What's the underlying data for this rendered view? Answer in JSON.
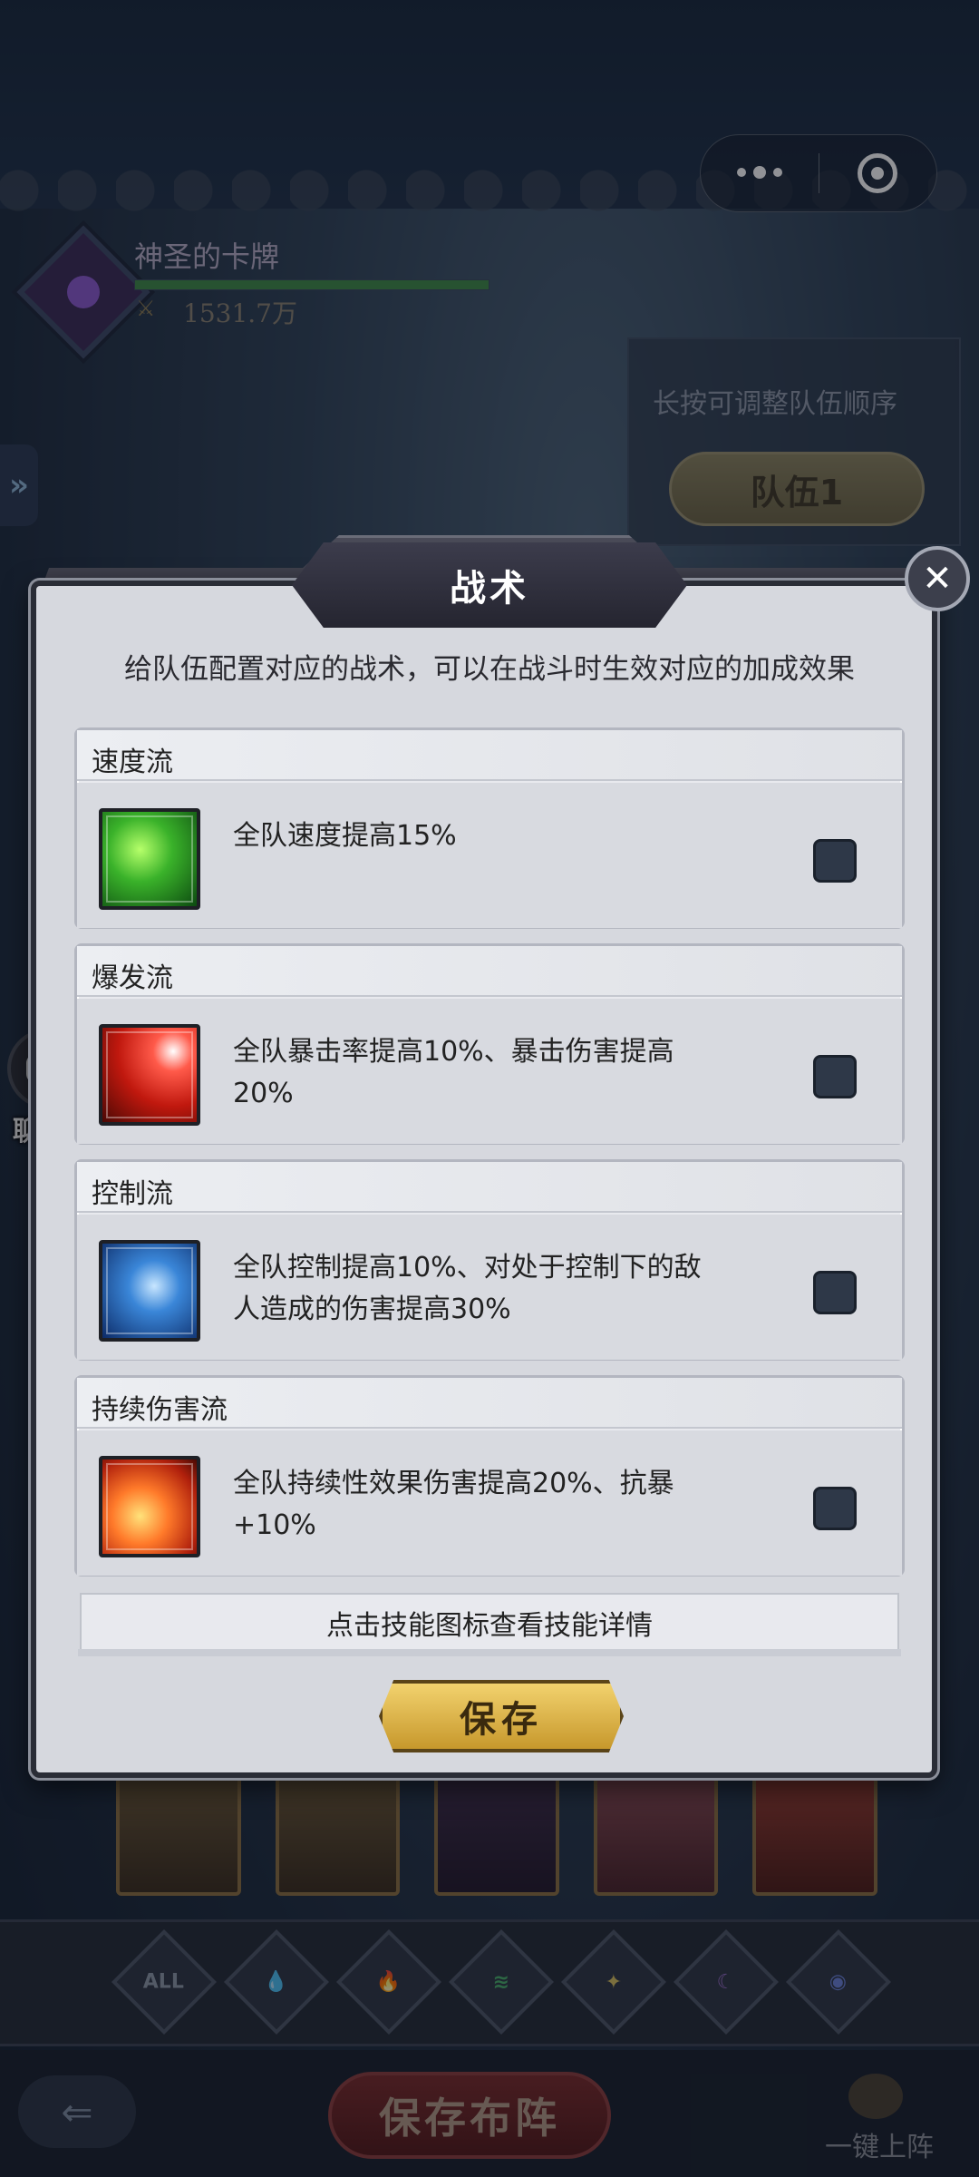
{
  "top_menu": {
    "more_icon": "more-dots-icon",
    "close_icon": "target-circle-icon"
  },
  "team": {
    "name": "神圣的卡牌",
    "power": "1531.7万",
    "power_bar_fill": 1.0
  },
  "reorder": {
    "hint": "长按可调整队伍顺序",
    "team_button": "队伍1"
  },
  "chat": {
    "label": "聊天"
  },
  "tactics_modal": {
    "title": "战术",
    "description": "给队伍配置对应的战术，可以在战斗时生效对应的加成效果",
    "tactics": [
      {
        "name": "速度流",
        "effect": "全队速度提高15%",
        "icon": "speed-skill-icon",
        "checked": false
      },
      {
        "name": "爆发流",
        "effect": "全队暴击率提高10%、暴击伤害提高20%",
        "icon": "burst-skill-icon",
        "checked": false
      },
      {
        "name": "控制流",
        "effect": "全队控制提高10%、对处于控制下的敌人造成的伤害提高30%",
        "icon": "control-skill-icon",
        "checked": false
      },
      {
        "name": "持续伤害流",
        "effect": "全队持续性效果伤害提高20%、抗暴+10%",
        "icon": "dot-skill-icon",
        "checked": false
      }
    ],
    "footer_hint": "点击技能图标查看技能详情",
    "save_label": "保存"
  },
  "filters": [
    "ALL",
    "water",
    "fire",
    "wind",
    "light",
    "dark",
    "void"
  ],
  "bottom": {
    "save_formation": "保存布阵",
    "one_key": "一键上阵"
  }
}
